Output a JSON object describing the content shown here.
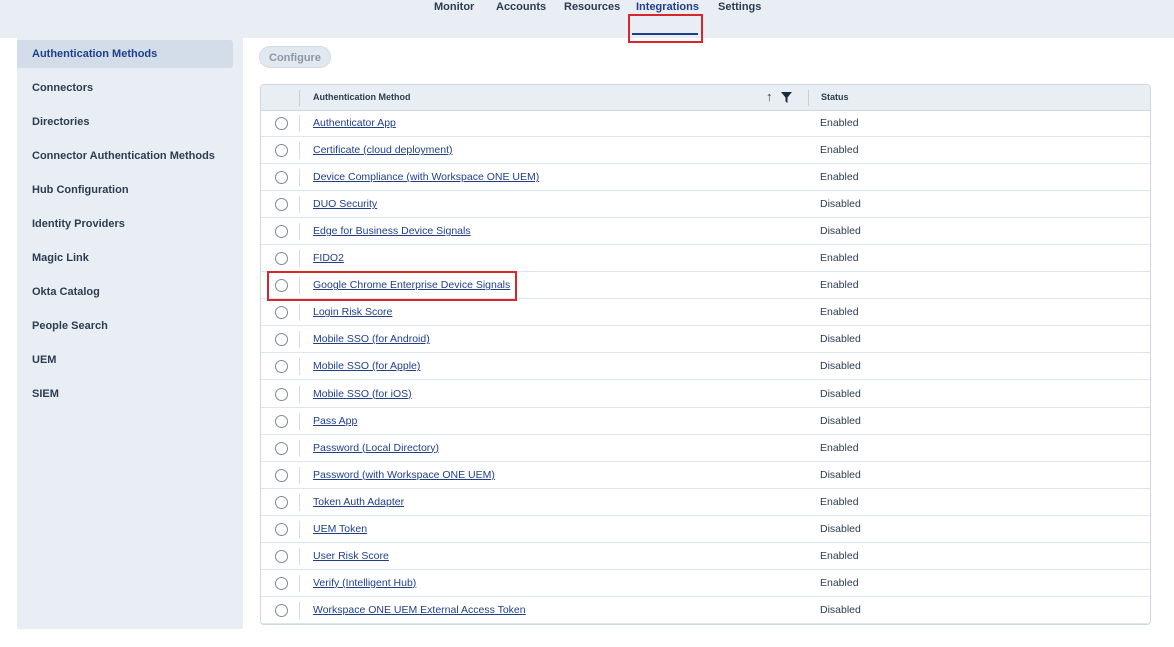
{
  "topnav": {
    "tabs": [
      "Monitor",
      "Accounts",
      "Resources",
      "Integrations",
      "Settings"
    ],
    "active": "Integrations"
  },
  "sidebar": {
    "items": [
      "Authentication Methods",
      "Connectors",
      "Directories",
      "Connector Authentication Methods",
      "Hub Configuration",
      "Identity Providers",
      "Magic Link",
      "Okta Catalog",
      "People Search",
      "UEM",
      "SIEM"
    ],
    "active": "Authentication Methods"
  },
  "toolbar": {
    "configure_label": "Configure"
  },
  "table": {
    "headers": {
      "method": "Authentication Method",
      "status": "Status"
    },
    "rows": [
      {
        "method": "Authenticator App",
        "status": "Enabled"
      },
      {
        "method": "Certificate (cloud deployment)",
        "status": "Enabled"
      },
      {
        "method": "Device Compliance (with Workspace ONE UEM)",
        "status": "Enabled"
      },
      {
        "method": "DUO Security",
        "status": "Disabled"
      },
      {
        "method": "Edge for Business Device Signals",
        "status": "Disabled"
      },
      {
        "method": "FIDO2",
        "status": "Enabled"
      },
      {
        "method": "Google Chrome Enterprise Device Signals",
        "status": "Enabled"
      },
      {
        "method": "Login Risk Score",
        "status": "Enabled"
      },
      {
        "method": "Mobile SSO (for Android)",
        "status": "Disabled"
      },
      {
        "method": "Mobile SSO (for Apple)",
        "status": "Disabled"
      },
      {
        "method": "Mobile SSO (for iOS)",
        "status": "Disabled"
      },
      {
        "method": "Pass App",
        "status": "Disabled"
      },
      {
        "method": "Password (Local Directory)",
        "status": "Enabled"
      },
      {
        "method": "Password (with Workspace ONE UEM)",
        "status": "Disabled"
      },
      {
        "method": "Token Auth Adapter",
        "status": "Enabled"
      },
      {
        "method": "UEM Token",
        "status": "Disabled"
      },
      {
        "method": "User Risk Score",
        "status": "Enabled"
      },
      {
        "method": "Verify (Intelligent Hub)",
        "status": "Enabled"
      },
      {
        "method": "Workspace ONE UEM External Access Token",
        "status": "Disabled"
      }
    ]
  },
  "colors": {
    "accent": "#1f3f8a",
    "highlight": "#d8262d",
    "panel": "#e9eef4"
  },
  "icons": {
    "sort": "arrow-up-icon",
    "filter": "filter-icon"
  }
}
